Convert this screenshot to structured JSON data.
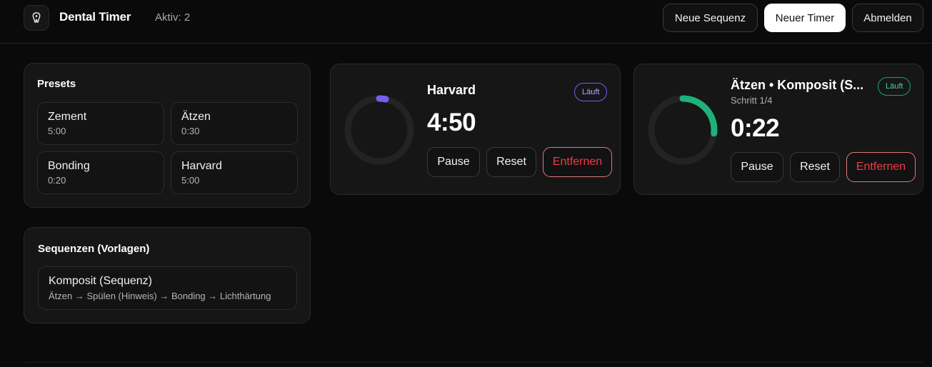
{
  "header": {
    "title": "Dental Timer",
    "active_label": "Aktiv: 2",
    "buttons": {
      "new_sequence": "Neue Sequenz",
      "new_timer": "Neuer Timer",
      "logout": "Abmelden"
    }
  },
  "presets": {
    "title": "Presets",
    "items": [
      {
        "name": "Zement",
        "time": "5:00"
      },
      {
        "name": "Ätzen",
        "time": "0:30"
      },
      {
        "name": "Bonding",
        "time": "0:20"
      },
      {
        "name": "Harvard",
        "time": "5:00"
      }
    ]
  },
  "sequences": {
    "title": "Sequenzen (Vorlagen)",
    "items": [
      {
        "name": "Komposit (Sequenz)",
        "steps": "Ätzen → Spülen (Hinweis) → Bonding → Lichthärtung"
      }
    ]
  },
  "timers": [
    {
      "name": "Harvard",
      "status": "Läuft",
      "time": "4:50",
      "progress": 0.033,
      "color": "#7c5cf0",
      "buttons": {
        "pause": "Pause",
        "reset": "Reset",
        "remove": "Entfernen"
      }
    },
    {
      "name": "Ätzen • Komposit (S...",
      "step": "Schritt 1/4",
      "status": "Läuft",
      "time": "0:22",
      "progress": 0.267,
      "color": "#1db27a",
      "buttons": {
        "pause": "Pause",
        "reset": "Reset",
        "remove": "Entfernen"
      }
    }
  ],
  "colors": {
    "background": "#0a0a0a",
    "panel": "#161616",
    "danger": "#f33a45"
  }
}
